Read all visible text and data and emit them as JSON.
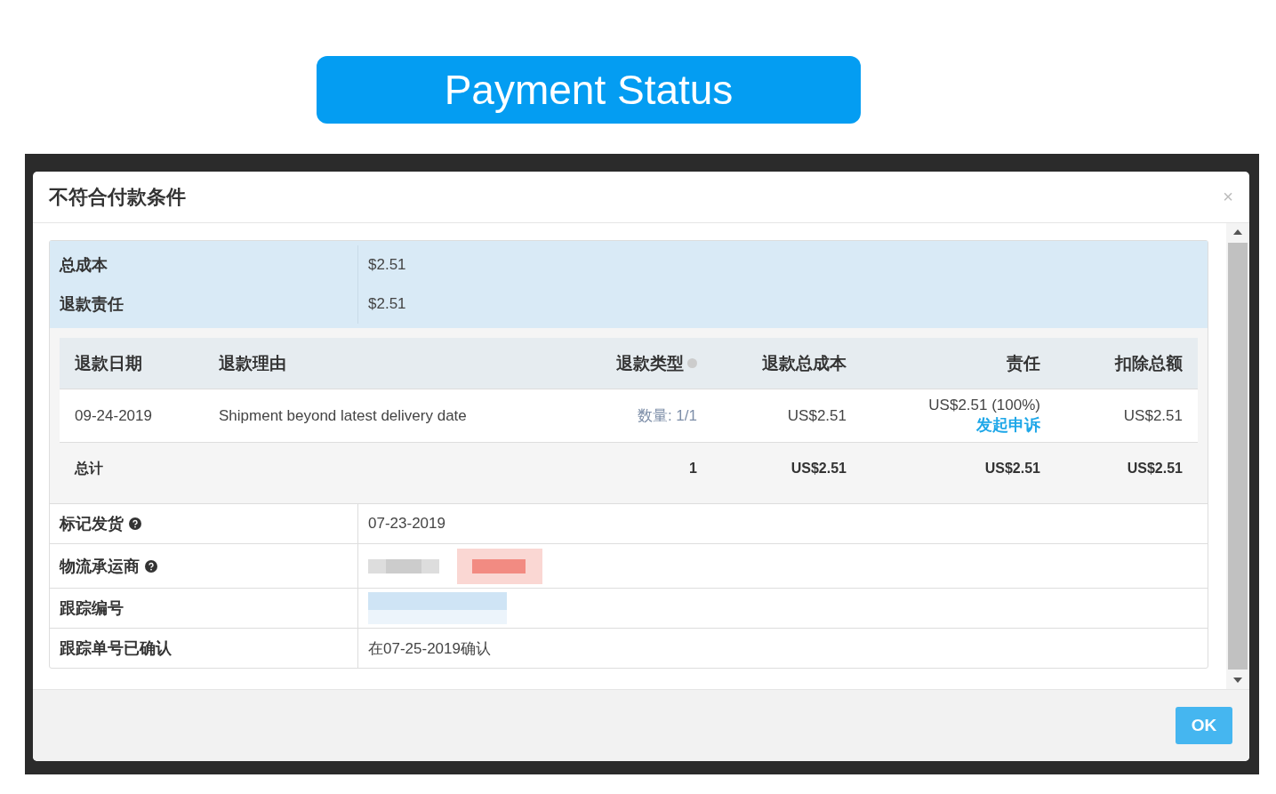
{
  "banner": {
    "title": "Payment Status"
  },
  "dialog": {
    "title": "不符合付款条件",
    "close": "×",
    "summary": [
      {
        "label": "总成本",
        "value": "$2.51"
      },
      {
        "label": "退款责任",
        "value": "$2.51"
      }
    ],
    "refunds": {
      "columns": [
        {
          "label": "退款日期",
          "info": false
        },
        {
          "label": "退款理由",
          "info": false
        },
        {
          "label": "退款类型",
          "info": true
        },
        {
          "label": "退款总成本",
          "info": false
        },
        {
          "label": "责任",
          "info": false
        },
        {
          "label": "扣除总额",
          "info": false
        }
      ],
      "rows": [
        {
          "date": "09-24-2019",
          "reason": "Shipment beyond latest delivery date",
          "type": "数量: 1/1",
          "cost": "US$2.51",
          "liability": "US$2.51 (100%)",
          "appeal": "发起申诉",
          "deducted": "US$2.51"
        }
      ],
      "total": {
        "label": "总计",
        "type": "1",
        "cost": "US$2.51",
        "liability": "US$2.51",
        "deducted": "US$2.51"
      }
    },
    "details": [
      {
        "label": "标记发货",
        "help": true,
        "kind": "text",
        "value": "07-23-2019"
      },
      {
        "label": "物流承运商",
        "help": true,
        "kind": "redacted"
      },
      {
        "label": "跟踪编号",
        "help": false,
        "kind": "redacted"
      },
      {
        "label": "跟踪单号已确认",
        "help": false,
        "kind": "text",
        "value": "在07-25-2019确认"
      }
    ],
    "ok": "OK"
  }
}
